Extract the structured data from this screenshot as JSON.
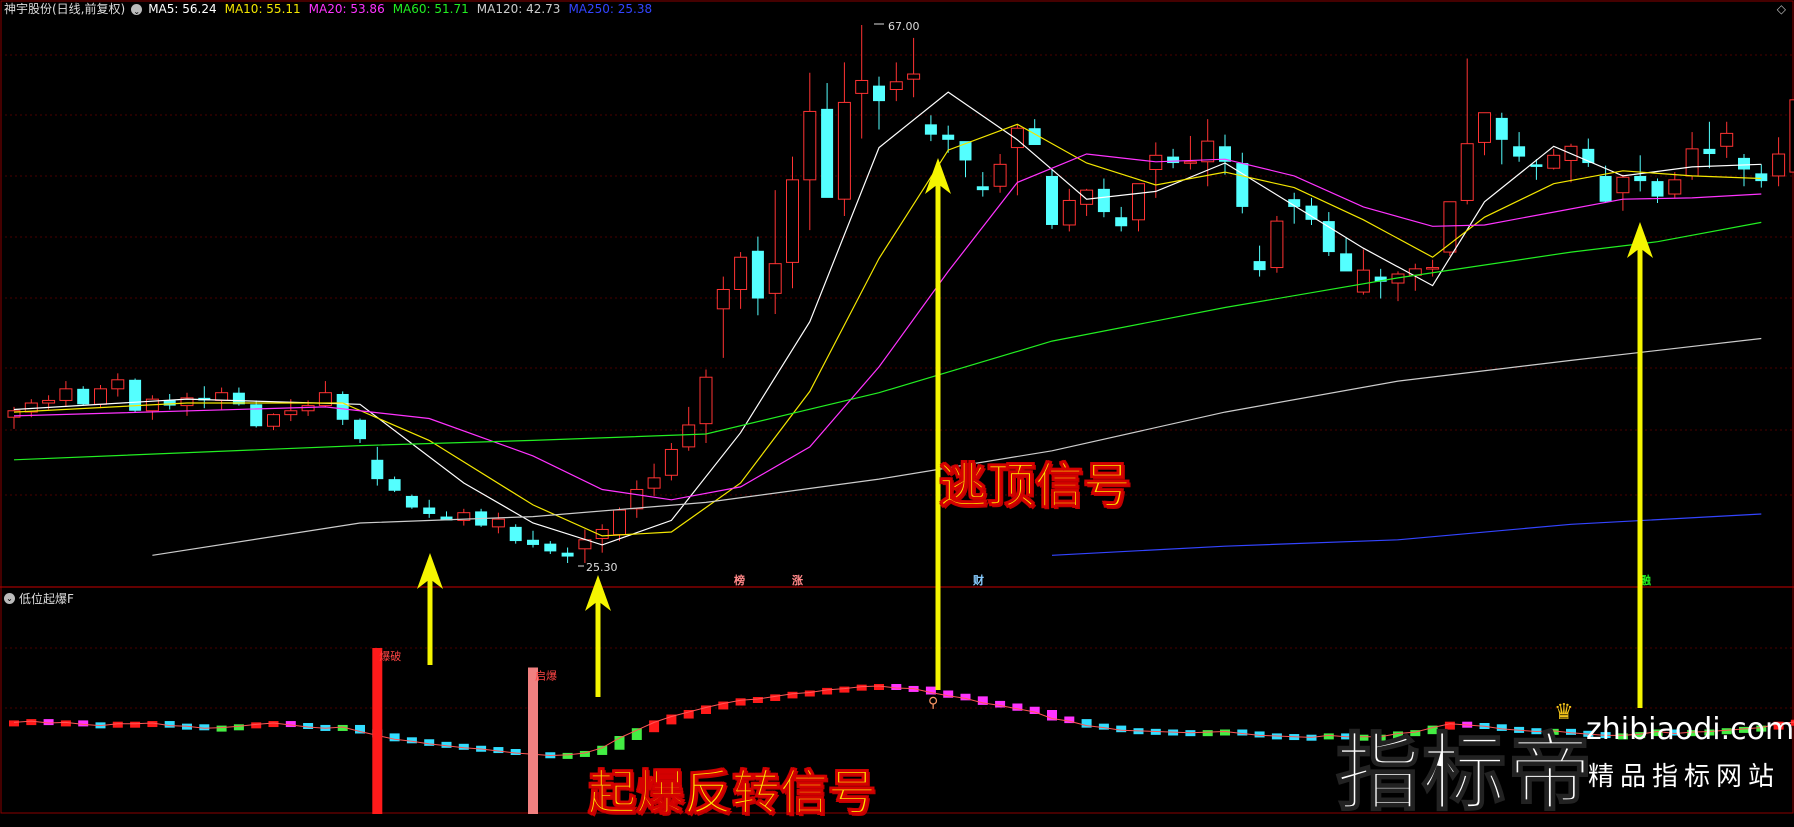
{
  "header": {
    "title": "神宇股份(日线,前复权)",
    "indicators": [
      {
        "label": "MA5: 56.24",
        "color": "#ffffff"
      },
      {
        "label": "MA10: 55.11",
        "color": "#f3e600"
      },
      {
        "label": "MA20: 53.86",
        "color": "#ff33ff"
      },
      {
        "label": "MA60: 51.71",
        "color": "#22ee22"
      },
      {
        "label": "MA120: 42.73",
        "color": "#cccccc"
      },
      {
        "label": "MA250: 25.38",
        "color": "#3344ff"
      }
    ]
  },
  "sub_header": {
    "title": "低位起爆F"
  },
  "price_labels": {
    "high": "67.00",
    "low": "25.30"
  },
  "event_tags": [
    {
      "text": "榜",
      "color": "#ff8888"
    },
    {
      "text": "涨",
      "color": "#ff8888"
    },
    {
      "text": "财",
      "color": "#88ccff"
    },
    {
      "text": "融",
      "color": "#22ee22"
    }
  ],
  "signal_labels": {
    "bao_po": "爆破",
    "qi_bao": "启爆"
  },
  "annotations": {
    "escape": "逃顶信号",
    "reversal": "起爆反转信号"
  },
  "watermark": {
    "cn": "指标帝",
    "en": "zhibiaodi.com",
    "sub": "精品指标网站"
  },
  "colors": {
    "up": "#ff3333",
    "down": "#54ffff",
    "arrow": "#f5f500",
    "grid": "#4a0000"
  },
  "chart_data": {
    "type": "candlestick",
    "y_range": [
      25.3,
      67.0
    ],
    "candles": [
      [
        36.6,
        37.4,
        35.7,
        37.1
      ],
      [
        37.0,
        38.0,
        36.6,
        37.7
      ],
      [
        37.7,
        38.3,
        37.2,
        37.9
      ],
      [
        37.9,
        39.4,
        37.4,
        38.8
      ],
      [
        38.8,
        39.0,
        37.5,
        37.6
      ],
      [
        37.6,
        39.1,
        37.3,
        38.8
      ],
      [
        38.8,
        40.0,
        38.2,
        39.5
      ],
      [
        39.5,
        39.6,
        37.0,
        37.1
      ],
      [
        37.1,
        38.3,
        36.4,
        38.0
      ],
      [
        37.9,
        38.4,
        37.2,
        37.5
      ],
      [
        37.5,
        38.5,
        36.7,
        38.1
      ],
      [
        38.1,
        39.0,
        37.3,
        37.9
      ],
      [
        37.9,
        38.9,
        37.2,
        38.5
      ],
      [
        38.5,
        38.9,
        37.5,
        37.6
      ],
      [
        37.6,
        37.9,
        35.8,
        35.9
      ],
      [
        35.9,
        36.9,
        35.6,
        36.8
      ],
      [
        36.8,
        38.0,
        36.3,
        37.1
      ],
      [
        37.1,
        37.9,
        36.7,
        37.5
      ],
      [
        37.5,
        39.4,
        37.4,
        38.5
      ],
      [
        38.4,
        38.6,
        36.0,
        36.4
      ],
      [
        36.4,
        36.5,
        34.6,
        34.9
      ],
      [
        33.3,
        34.3,
        31.3,
        31.8
      ],
      [
        31.8,
        32.0,
        30.8,
        30.9
      ],
      [
        30.5,
        30.6,
        29.5,
        29.6
      ],
      [
        29.6,
        30.2,
        28.8,
        29.1
      ],
      [
        28.9,
        29.3,
        28.7,
        28.6
      ],
      [
        28.6,
        29.5,
        28.2,
        29.2
      ],
      [
        29.3,
        29.5,
        28.1,
        28.2
      ],
      [
        28.1,
        29.2,
        27.6,
        28.7
      ],
      [
        28.1,
        28.3,
        26.8,
        27.0
      ],
      [
        27.1,
        27.8,
        26.5,
        26.7
      ],
      [
        26.8,
        27.0,
        26.0,
        26.2
      ],
      [
        26.1,
        26.5,
        25.3,
        25.8
      ],
      [
        26.4,
        27.9,
        25.3,
        27.1
      ],
      [
        27.2,
        28.3,
        26.1,
        27.9
      ],
      [
        27.5,
        29.6,
        27.0,
        29.4
      ],
      [
        29.5,
        31.7,
        28.8,
        31.0
      ],
      [
        31.1,
        33.0,
        30.5,
        31.9
      ],
      [
        32.1,
        34.6,
        31.7,
        34.1
      ],
      [
        34.3,
        37.4,
        34.0,
        36.0
      ],
      [
        36.1,
        40.3,
        34.6,
        39.7
      ],
      [
        45.0,
        47.5,
        41.2,
        46.5
      ],
      [
        46.5,
        49.4,
        45.0,
        49.0
      ],
      [
        49.5,
        50.6,
        44.5,
        45.8
      ],
      [
        46.2,
        54.2,
        44.6,
        48.5
      ],
      [
        48.6,
        56.8,
        46.6,
        55.0
      ],
      [
        55.0,
        63.3,
        51.1,
        60.3
      ],
      [
        60.5,
        62.5,
        54.3,
        53.6
      ],
      [
        53.5,
        64.1,
        52.2,
        61.0
      ],
      [
        61.7,
        67.0,
        58.2,
        62.7
      ],
      [
        62.3,
        63.0,
        58.9,
        61.1
      ],
      [
        62.0,
        64.1,
        61.1,
        62.6
      ],
      [
        62.8,
        66.0,
        61.4,
        63.2
      ],
      [
        59.3,
        60.0,
        58.0,
        58.5
      ],
      [
        58.5,
        59.2,
        57.1,
        58.1
      ],
      [
        58.0,
        57.8,
        55.2,
        56.5
      ],
      [
        54.5,
        55.6,
        53.7,
        54.2
      ],
      [
        54.5,
        57.0,
        54.0,
        56.2
      ],
      [
        57.5,
        59.3,
        53.8,
        59.0
      ],
      [
        59.0,
        59.7,
        57.8,
        57.7
      ],
      [
        55.3,
        55.8,
        51.2,
        51.5
      ],
      [
        51.5,
        54.3,
        51.0,
        53.4
      ],
      [
        53.1,
        54.3,
        52.2,
        54.2
      ],
      [
        54.3,
        55.1,
        52.1,
        52.5
      ],
      [
        52.1,
        52.9,
        51.0,
        51.4
      ],
      [
        51.9,
        54.7,
        51.0,
        54.7
      ],
      [
        55.8,
        57.9,
        53.6,
        56.9
      ],
      [
        56.8,
        57.4,
        55.9,
        56.3
      ],
      [
        56.3,
        58.4,
        55.8,
        56.4
      ],
      [
        56.4,
        59.7,
        54.5,
        58.0
      ],
      [
        57.6,
        58.5,
        55.4,
        56.4
      ],
      [
        56.3,
        57.1,
        52.4,
        52.9
      ],
      [
        48.7,
        49.9,
        47.5,
        48.0
      ],
      [
        48.2,
        52.2,
        47.8,
        51.8
      ],
      [
        53.5,
        54.0,
        51.6,
        52.9
      ],
      [
        53.0,
        53.6,
        51.5,
        51.9
      ],
      [
        51.8,
        52.5,
        49.1,
        49.4
      ],
      [
        49.3,
        50.5,
        48.6,
        47.9
      ],
      [
        46.3,
        49.6,
        46.1,
        48.0
      ],
      [
        47.5,
        48.1,
        45.8,
        47.1
      ],
      [
        47.0,
        47.9,
        45.6,
        47.7
      ],
      [
        47.6,
        48.5,
        46.4,
        48.1
      ],
      [
        48.1,
        48.8,
        47.5,
        48.2
      ],
      [
        49.4,
        50.7,
        49.1,
        53.3
      ],
      [
        53.4,
        64.4,
        53.1,
        57.8
      ],
      [
        57.9,
        59.0,
        56.9,
        60.2
      ],
      [
        59.8,
        60.2,
        56.2,
        58.1
      ],
      [
        57.6,
        58.7,
        56.4,
        56.8
      ],
      [
        56.2,
        56.6,
        55.0,
        56.0
      ],
      [
        55.9,
        57.4,
        55.8,
        56.9
      ],
      [
        56.5,
        57.8,
        54.8,
        57.6
      ],
      [
        57.4,
        58.2,
        56.0,
        56.3
      ],
      [
        55.3,
        56.1,
        53.2,
        53.3
      ],
      [
        54.0,
        55.4,
        52.6,
        55.2
      ],
      [
        55.3,
        56.9,
        54.1,
        54.9
      ],
      [
        54.9,
        55.1,
        53.2,
        53.7
      ],
      [
        53.9,
        55.6,
        53.6,
        55.0
      ],
      [
        55.3,
        58.7,
        55.0,
        57.4
      ],
      [
        57.4,
        59.5,
        55.9,
        57.0
      ],
      [
        57.6,
        59.5,
        56.7,
        58.6
      ],
      [
        56.7,
        57.0,
        54.5,
        55.8
      ],
      [
        55.5,
        56.2,
        54.4,
        54.9
      ],
      [
        55.3,
        58.3,
        54.5,
        57.0
      ],
      [
        55.6,
        60.3,
        55.2,
        61.2
      ],
      [
        61.0,
        63.0,
        56.6,
        57.6
      ]
    ],
    "series": [
      {
        "name": "MA5",
        "color": "#ffffff",
        "last": 56.24
      },
      {
        "name": "MA10",
        "color": "#f3e600",
        "last": 55.11
      },
      {
        "name": "MA20",
        "color": "#ff33ff",
        "last": 53.86
      },
      {
        "name": "MA60",
        "color": "#22ee22",
        "last": 51.71
      },
      {
        "name": "MA120",
        "color": "#cccccc",
        "last": 42.73
      },
      {
        "name": "MA250",
        "color": "#3344ff",
        "last": 25.38
      }
    ],
    "ma_paths": {
      "MA5": [
        [
          0,
          37.2
        ],
        [
          10,
          38.0
        ],
        [
          20,
          37.6
        ],
        [
          26,
          31.5
        ],
        [
          30,
          28.4
        ],
        [
          34,
          26.7
        ],
        [
          38,
          28.6
        ],
        [
          42,
          35.4
        ],
        [
          46,
          44.0
        ],
        [
          50,
          57.5
        ],
        [
          54,
          61.8
        ],
        [
          58,
          58.1
        ],
        [
          62,
          53.5
        ],
        [
          66,
          54.1
        ],
        [
          70,
          56.3
        ],
        [
          74,
          53.0
        ],
        [
          78,
          49.7
        ],
        [
          82,
          46.8
        ],
        [
          85,
          53.3
        ],
        [
          89,
          57.6
        ],
        [
          93,
          55.3
        ],
        [
          97,
          56.0
        ],
        [
          101,
          56.2
        ]
      ],
      "MA10": [
        [
          0,
          37.0
        ],
        [
          10,
          37.7
        ],
        [
          19,
          37.7
        ],
        [
          24,
          34.8
        ],
        [
          30,
          29.8
        ],
        [
          34,
          27.4
        ],
        [
          38,
          27.7
        ],
        [
          42,
          31.5
        ],
        [
          46,
          38.6
        ],
        [
          50,
          48.9
        ],
        [
          54,
          57.3
        ],
        [
          58,
          59.3
        ],
        [
          62,
          56.3
        ],
        [
          66,
          54.6
        ],
        [
          70,
          55.6
        ],
        [
          74,
          54.4
        ],
        [
          78,
          51.9
        ],
        [
          82,
          49.0
        ],
        [
          85,
          52.1
        ],
        [
          89,
          54.7
        ],
        [
          93,
          55.7
        ],
        [
          97,
          55.3
        ],
        [
          101,
          55.1
        ]
      ],
      "MA20": [
        [
          0,
          36.7
        ],
        [
          18,
          37.4
        ],
        [
          24,
          36.5
        ],
        [
          30,
          33.6
        ],
        [
          34,
          31.0
        ],
        [
          38,
          30.2
        ],
        [
          42,
          31.2
        ],
        [
          46,
          34.3
        ],
        [
          50,
          40.5
        ],
        [
          54,
          47.9
        ],
        [
          58,
          54.8
        ],
        [
          62,
          57.0
        ],
        [
          66,
          56.4
        ],
        [
          70,
          56.6
        ],
        [
          74,
          55.3
        ],
        [
          78,
          52.9
        ],
        [
          82,
          51.4
        ],
        [
          85,
          51.5
        ],
        [
          89,
          52.5
        ],
        [
          93,
          53.5
        ],
        [
          97,
          53.6
        ],
        [
          101,
          53.9
        ]
      ],
      "MA60": [
        [
          0,
          33.3
        ],
        [
          20,
          34.4
        ],
        [
          30,
          34.8
        ],
        [
          40,
          35.3
        ],
        [
          50,
          38.5
        ],
        [
          60,
          42.5
        ],
        [
          70,
          45.1
        ],
        [
          80,
          47.4
        ],
        [
          90,
          49.4
        ],
        [
          95,
          50.2
        ],
        [
          101,
          51.7
        ]
      ],
      "MA120": [
        [
          8,
          25.9
        ],
        [
          20,
          28.4
        ],
        [
          30,
          28.9
        ],
        [
          40,
          30.0
        ],
        [
          50,
          31.8
        ],
        [
          60,
          34.0
        ],
        [
          70,
          37.0
        ],
        [
          80,
          39.4
        ],
        [
          90,
          41.0
        ],
        [
          101,
          42.7
        ]
      ],
      "MA250": [
        [
          60,
          25.9
        ],
        [
          70,
          26.6
        ],
        [
          80,
          27.1
        ],
        [
          90,
          28.3
        ],
        [
          101,
          29.1
        ]
      ]
    },
    "indicator_bars": [
      0.4,
      0.6,
      0.3,
      0.4,
      0.1,
      -0.1,
      0.2,
      0.2,
      0.3,
      -0.1,
      -0.2,
      -0.5,
      -0.4,
      -0.2,
      0.1,
      0.3,
      0.0,
      -0.3,
      -0.5,
      -0.3,
      -1.0,
      -1.6,
      -2.2,
      -2.5,
      -2.9,
      -3.2,
      -3.5,
      -3.7,
      -4.0,
      -4.3,
      -4.5,
      -4.7,
      -4.6,
      -4.3,
      -3.5,
      -2.0,
      -0.8,
      0.4,
      1.3,
      2.0,
      2.7,
      3.3,
      3.8,
      4.0,
      4.4,
      4.8,
      5.0,
      5.4,
      5.6,
      5.9,
      6.0,
      5.7,
      5.6,
      5.0,
      4.5,
      4.1,
      3.4,
      3.0,
      2.5,
      2.0,
      1.0,
      0.6,
      -0.1,
      -0.4,
      -0.8,
      -0.9,
      -1.0,
      -1.1,
      -1.2,
      -1.1,
      -1.0,
      -1.3,
      -1.6,
      -1.7,
      -1.8,
      -1.9,
      -1.6,
      -1.8,
      -1.8,
      -1.8,
      -1.3,
      -1.1,
      -0.4,
      0.2,
      0.0,
      -0.2,
      -0.6,
      -0.8,
      -1.0,
      -0.9,
      -1.2,
      -1.4,
      -1.6,
      -1.6,
      -1.4,
      -1.0,
      -1.3,
      -1.1,
      -1.0,
      -0.8,
      -0.6,
      -0.4,
      0.2,
      0.5
    ],
    "signals": [
      {
        "index": 21,
        "type": "bao_po",
        "height": 10
      },
      {
        "index": 30,
        "type": "qi_bao",
        "height": 7
      }
    ]
  }
}
